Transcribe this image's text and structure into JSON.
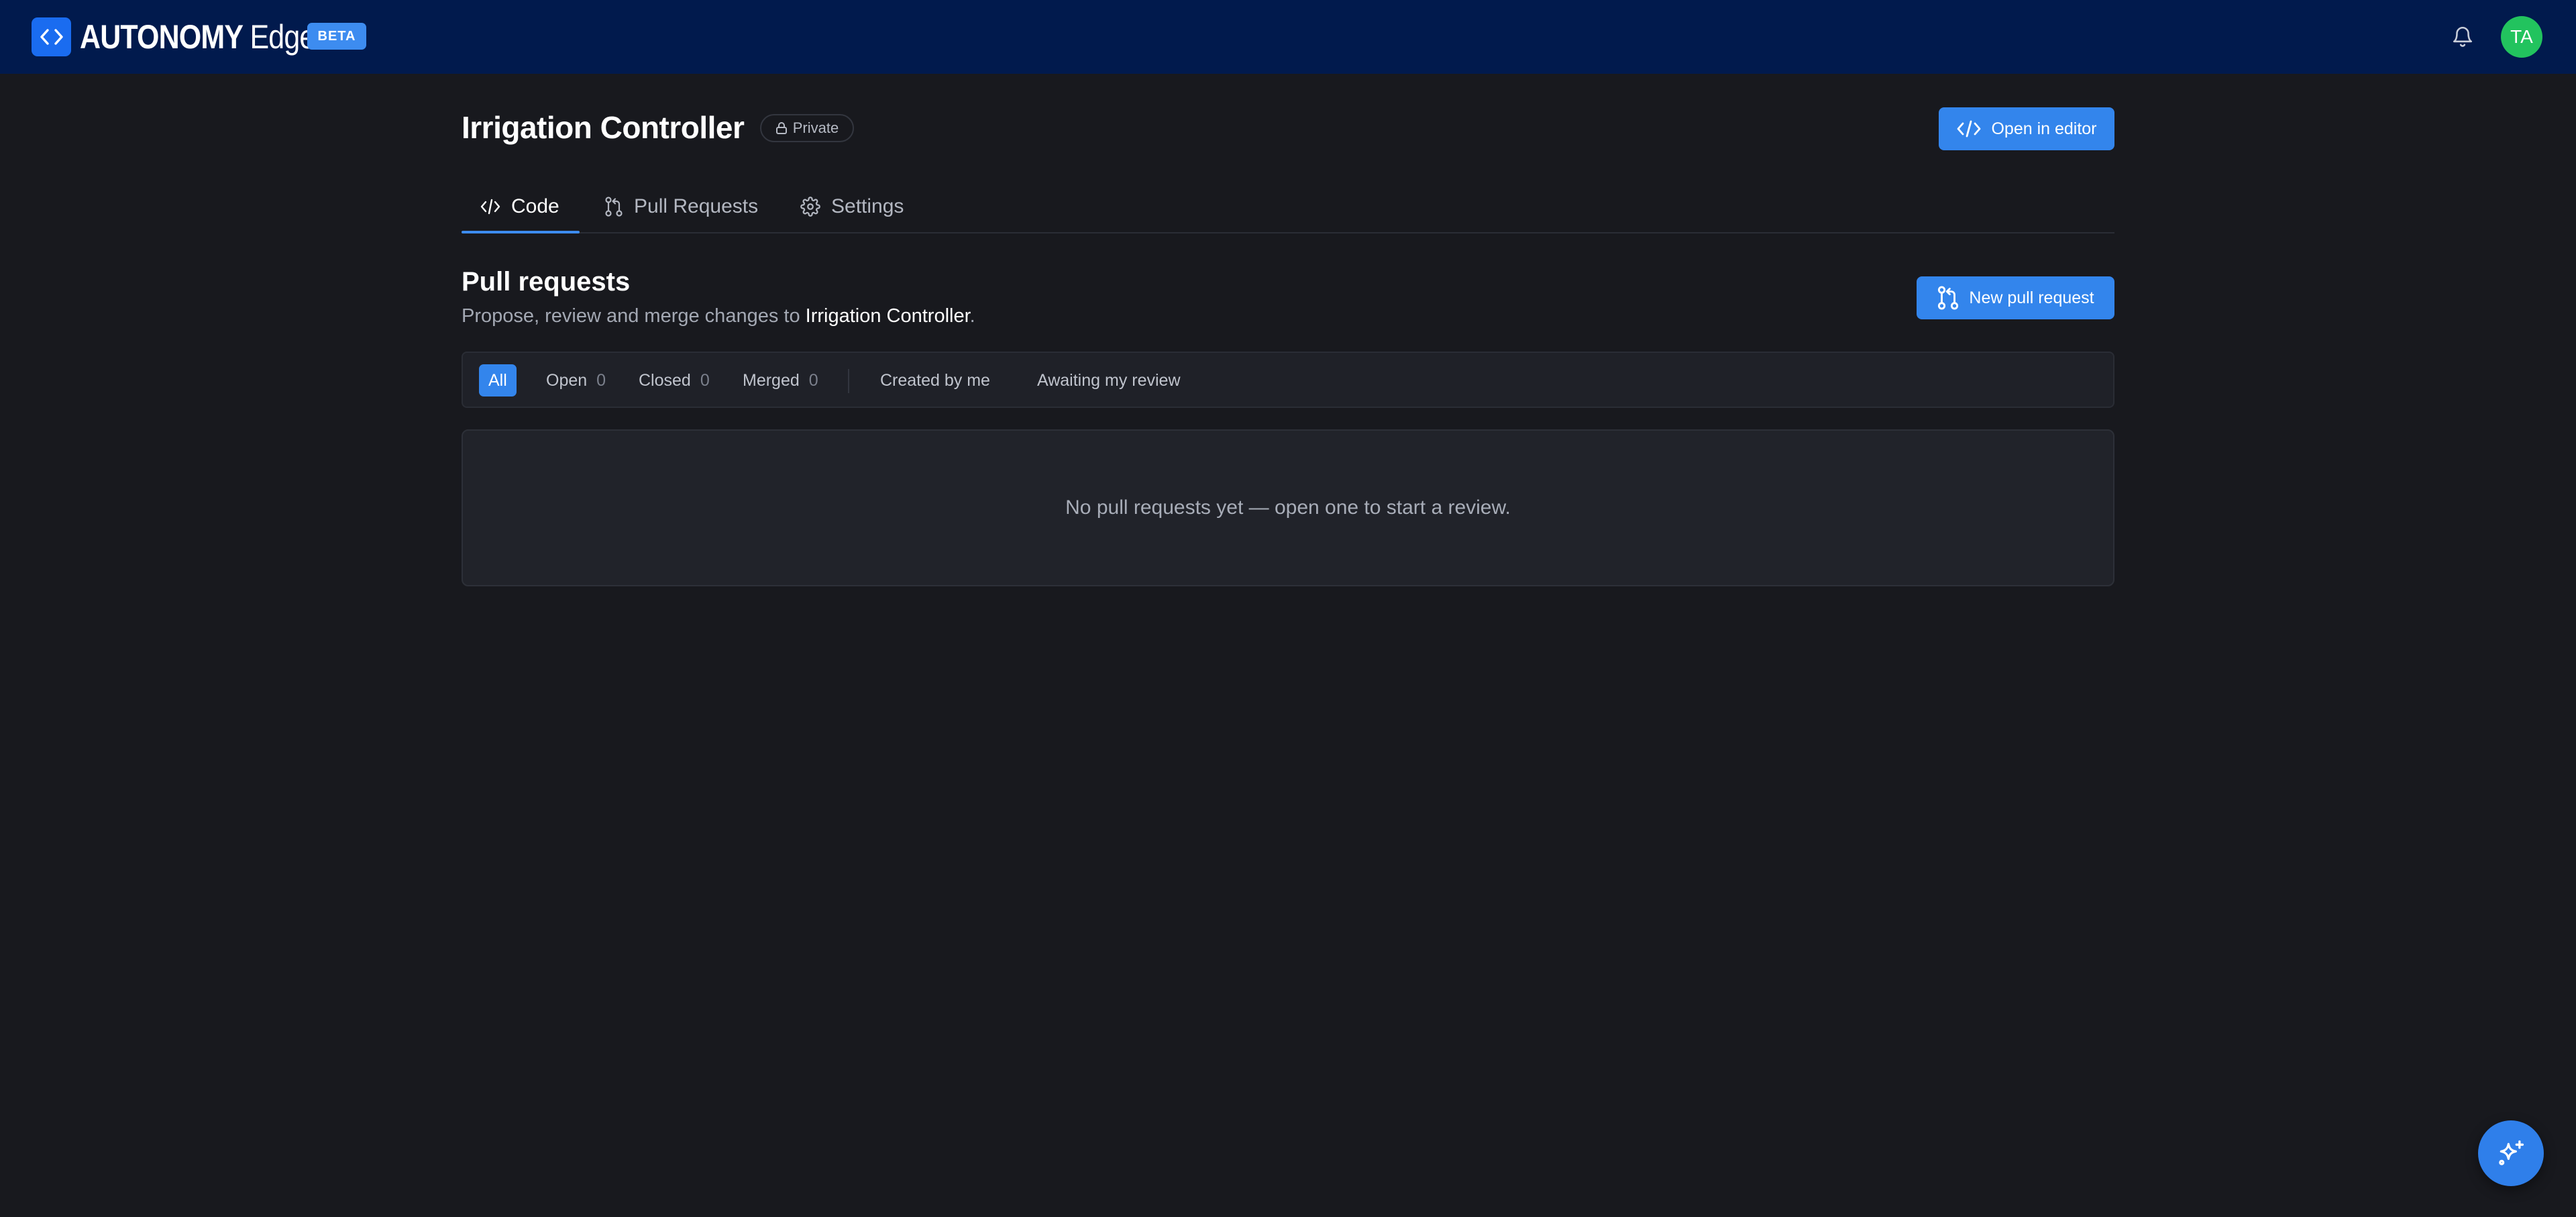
{
  "app": {
    "brand_strong": "AUTONOMY",
    "brand_light": "Edge",
    "badge": "BETA",
    "user_initials": "TA",
    "icons": {
      "logo": "code-brackets-icon",
      "notifications": "bell-icon",
      "assistant": "sparkles-icon"
    }
  },
  "repo": {
    "name": "Irrigation Controller",
    "visibility": "Private",
    "open_editor_label": "Open in editor"
  },
  "tabs": [
    {
      "label": "Code",
      "icon": "code-icon",
      "active": true
    },
    {
      "label": "Pull Requests",
      "icon": "git-pull-request-icon",
      "active": false
    },
    {
      "label": "Settings",
      "icon": "gear-icon",
      "active": false
    }
  ],
  "pull_requests": {
    "title": "Pull requests",
    "description_prefix": "Propose, review and merge changes to ",
    "description_repo": "Irrigation Controller",
    "description_suffix": ".",
    "new_button_label": "New pull request",
    "filters": {
      "all": "All",
      "open_label": "Open",
      "open_count": "0",
      "closed_label": "Closed",
      "closed_count": "0",
      "merged_label": "Merged",
      "merged_count": "0",
      "created_by_me": "Created by me",
      "awaiting_review": "Awaiting my review"
    },
    "empty_message": "No pull requests yet — open one to start a review."
  },
  "colors": {
    "topbar": "#011a4d",
    "background": "#18191e",
    "accent": "#3385ec",
    "avatar": "#22c35e"
  }
}
